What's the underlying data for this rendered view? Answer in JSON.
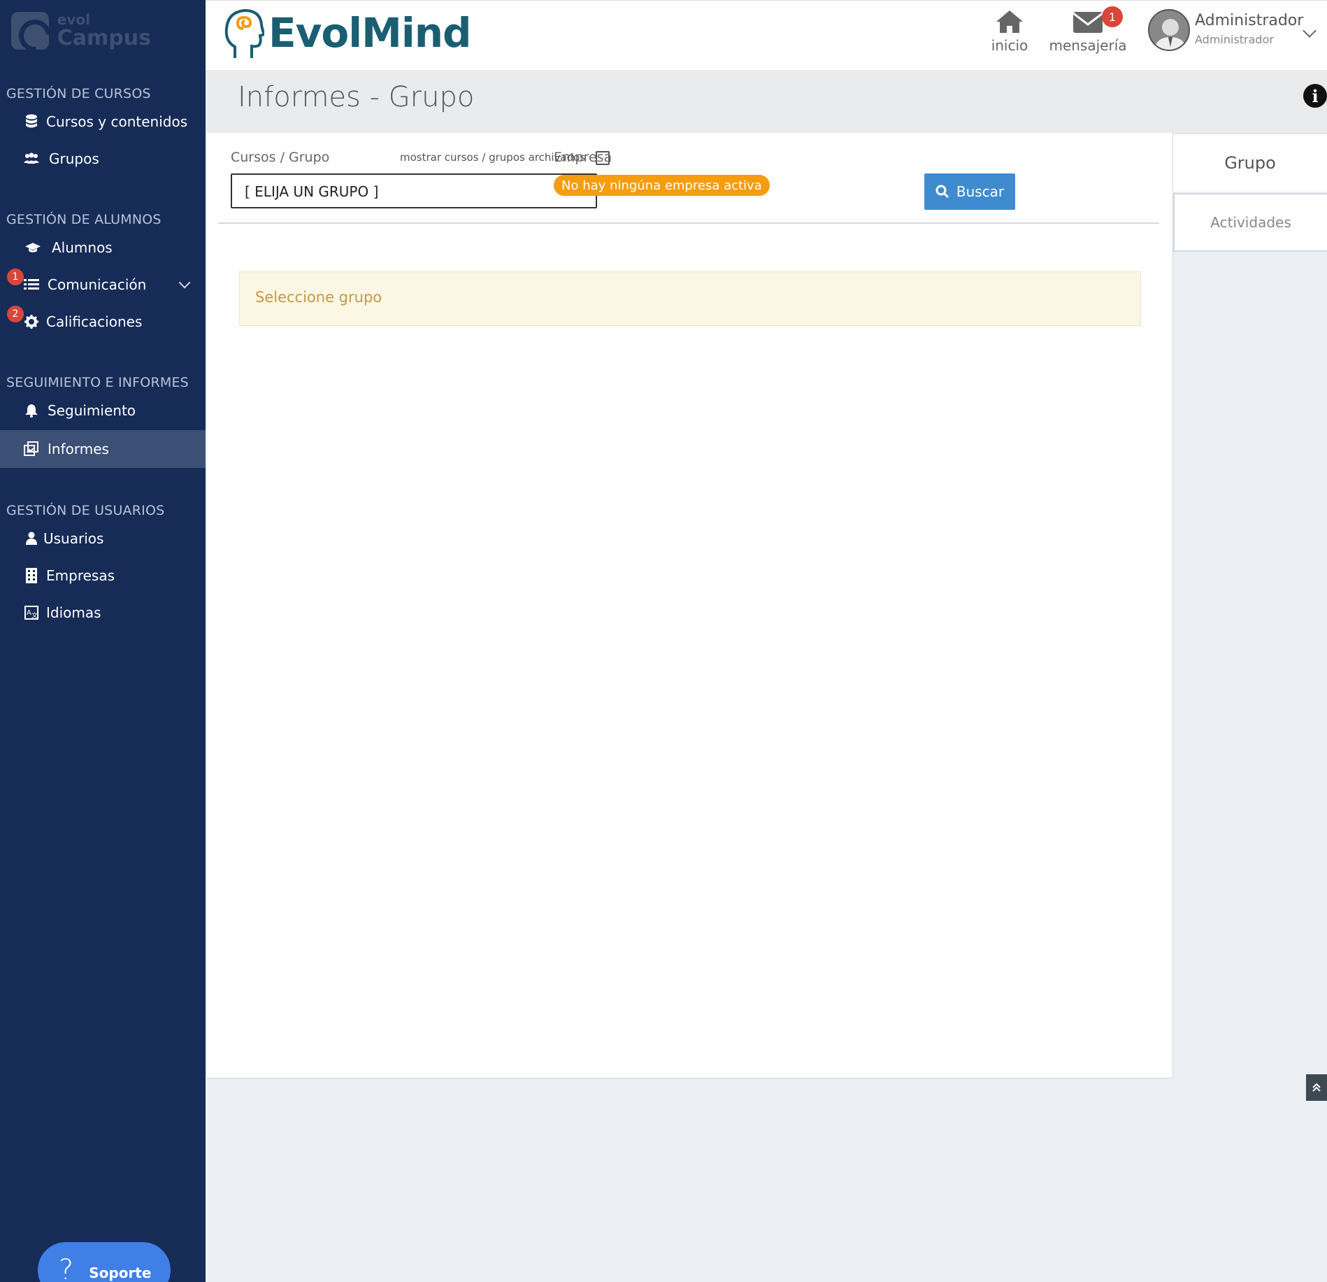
{
  "brand": {
    "top": "evol",
    "bottom": "Campus"
  },
  "sidebar": {
    "sections": [
      {
        "title": "GESTIÓN DE CURSOS"
      },
      {
        "title": "GESTIÓN DE ALUMNOS"
      },
      {
        "title": "SEGUIMIENTO E INFORMES"
      },
      {
        "title": "GESTIÓN DE USUARIOS"
      }
    ],
    "items": [
      {
        "label": "Cursos y contenidos",
        "icon": "database-icon"
      },
      {
        "label": "Grupos",
        "icon": "users-icon"
      },
      {
        "label": "Alumnos",
        "icon": "graduation-cap-icon"
      },
      {
        "label": "Comunicación",
        "icon": "list-icon",
        "badge": "1"
      },
      {
        "label": "Calificaciones",
        "icon": "gear-icon",
        "badge": "2"
      },
      {
        "label": "Seguimiento",
        "icon": "bell-icon"
      },
      {
        "label": "Informes",
        "icon": "report-icon",
        "active": true
      },
      {
        "label": "Usuarios",
        "icon": "user-icon"
      },
      {
        "label": "Empresas",
        "icon": "building-icon"
      },
      {
        "label": "Idiomas",
        "icon": "language-icon"
      }
    ],
    "support_label": "Soporte",
    "support_glyph": "?"
  },
  "header": {
    "logo_text": "EvolMind",
    "home_label": "inicio",
    "messages_label": "mensajería",
    "messages_badge": "1",
    "user_name": "Administrador",
    "user_role": "Administrador"
  },
  "page": {
    "title": "Informes - Grupo",
    "info_glyph": "i"
  },
  "form": {
    "courses_label": "Cursos / Grupo",
    "archived_label": "mostrar cursos / grupos archivados",
    "group_select_value": "[ ELIJA UN GRUPO ]",
    "company_label": "Empresa",
    "company_badge": "No hay ningúna empresa activa",
    "search_label": "Buscar"
  },
  "alert": {
    "text": "Seleccione grupo"
  },
  "tabs": [
    {
      "label": "Grupo",
      "active": true
    },
    {
      "label": "Actividades",
      "active": false
    }
  ],
  "colors": {
    "sidebar_bg": "#172b57",
    "sidebar_active": "#3c4f75",
    "brand_teal": "#1a5e72",
    "badge_red": "#d9463a",
    "company_orange": "#f59c0f",
    "search_blue": "#3f8bcf",
    "support_blue": "#3f7fe6"
  }
}
